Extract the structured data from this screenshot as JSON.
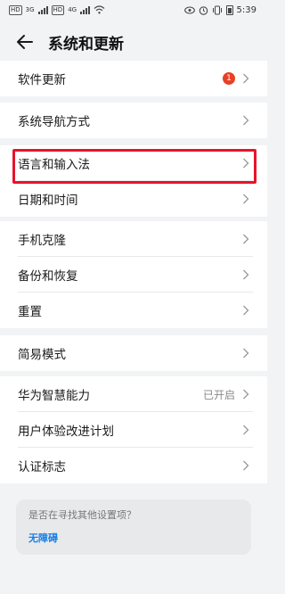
{
  "status_bar": {
    "network_chips": [
      "HD",
      "HD"
    ],
    "signal_labels": [
      "3G",
      "4G"
    ],
    "time": "5:39",
    "icons": [
      "wifi-icon",
      "eye-icon",
      "alarm-icon",
      "vibrate-icon",
      "battery-icon"
    ]
  },
  "header": {
    "title": "系统和更新",
    "back_icon": "arrow-left-icon"
  },
  "groups": [
    {
      "items": [
        {
          "id": "software-update",
          "label": "软件更新",
          "badge": "1"
        }
      ]
    },
    {
      "items": [
        {
          "id": "system-navigation",
          "label": "系统导航方式"
        }
      ]
    },
    {
      "items": [
        {
          "id": "language-input",
          "label": "语言和输入法",
          "highlighted": true
        },
        {
          "id": "date-time",
          "label": "日期和时间"
        }
      ]
    },
    {
      "items": [
        {
          "id": "phone-clone",
          "label": "手机克隆"
        },
        {
          "id": "backup-restore",
          "label": "备份和恢复"
        },
        {
          "id": "reset",
          "label": "重置"
        }
      ]
    },
    {
      "items": [
        {
          "id": "simple-mode",
          "label": "简易模式"
        }
      ]
    },
    {
      "items": [
        {
          "id": "huawei-smart",
          "label": "华为智慧能力",
          "value": "已开启"
        },
        {
          "id": "user-experience",
          "label": "用户体验改进计划"
        },
        {
          "id": "certification",
          "label": "认证标志"
        }
      ]
    }
  ],
  "suggestion": {
    "question": "是否在寻找其他设置项？",
    "link": "无障碍"
  },
  "colors": {
    "background": "#f1f3f5",
    "card": "#ffffff",
    "badge": "#e84026",
    "highlight_border": "#e8132a",
    "link": "#1a7ee8"
  }
}
